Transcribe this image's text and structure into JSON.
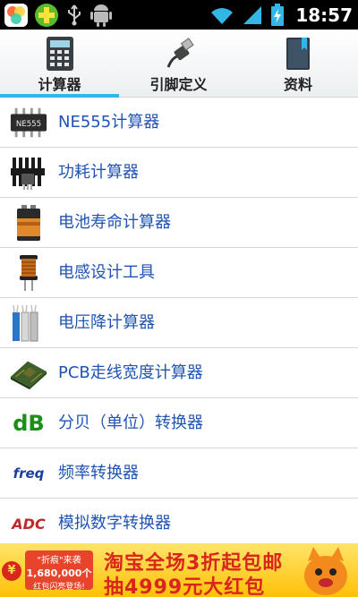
{
  "status_bar": {
    "time": "18:57",
    "left_icons": [
      "app-icon-colorful",
      "plus-app-icon",
      "usb-icon",
      "android-icon"
    ],
    "right_icons": [
      "wifi-icon",
      "signal-icon",
      "battery-charging-icon"
    ]
  },
  "tabs": [
    {
      "label": "计算器",
      "icon": "calculator-icon",
      "active": true
    },
    {
      "label": "引脚定义",
      "icon": "usb-plug-icon",
      "active": false
    },
    {
      "label": "资料",
      "icon": "book-icon",
      "active": false
    }
  ],
  "list": [
    {
      "label": "NE555计算器",
      "icon": "ne555-chip-icon"
    },
    {
      "label": "功耗计算器",
      "icon": "heatsink-icon"
    },
    {
      "label": "电池寿命计算器",
      "icon": "battery-icon"
    },
    {
      "label": "电感设计工具",
      "icon": "inductor-icon"
    },
    {
      "label": "电压降计算器",
      "icon": "wires-icon"
    },
    {
      "label": "PCB走线宽度计算器",
      "icon": "pcb-icon"
    },
    {
      "label": "分贝（单位）转换器",
      "icon": "db-icon"
    },
    {
      "label": "频率转换器",
      "icon": "freq-icon"
    },
    {
      "label": "模拟数字转换器",
      "icon": "adc-icon"
    }
  ],
  "icon_text": {
    "ne555": "NE555",
    "db": "dB",
    "freq": "freq",
    "adc": "ADC"
  },
  "ad": {
    "tag_line1": "\"折痕\"来袭",
    "tag_line2": "1,680,000个",
    "tag_line3": "红包闪亮登场!",
    "line1": "淘宝全场3折起包邮",
    "line2": "抽4999元大红包",
    "yen": "¥"
  },
  "colors": {
    "accent": "#33b5e5",
    "item_text": "#1f54b4",
    "ad_red": "#d9261c",
    "ad_yellow": "#ffc107"
  }
}
